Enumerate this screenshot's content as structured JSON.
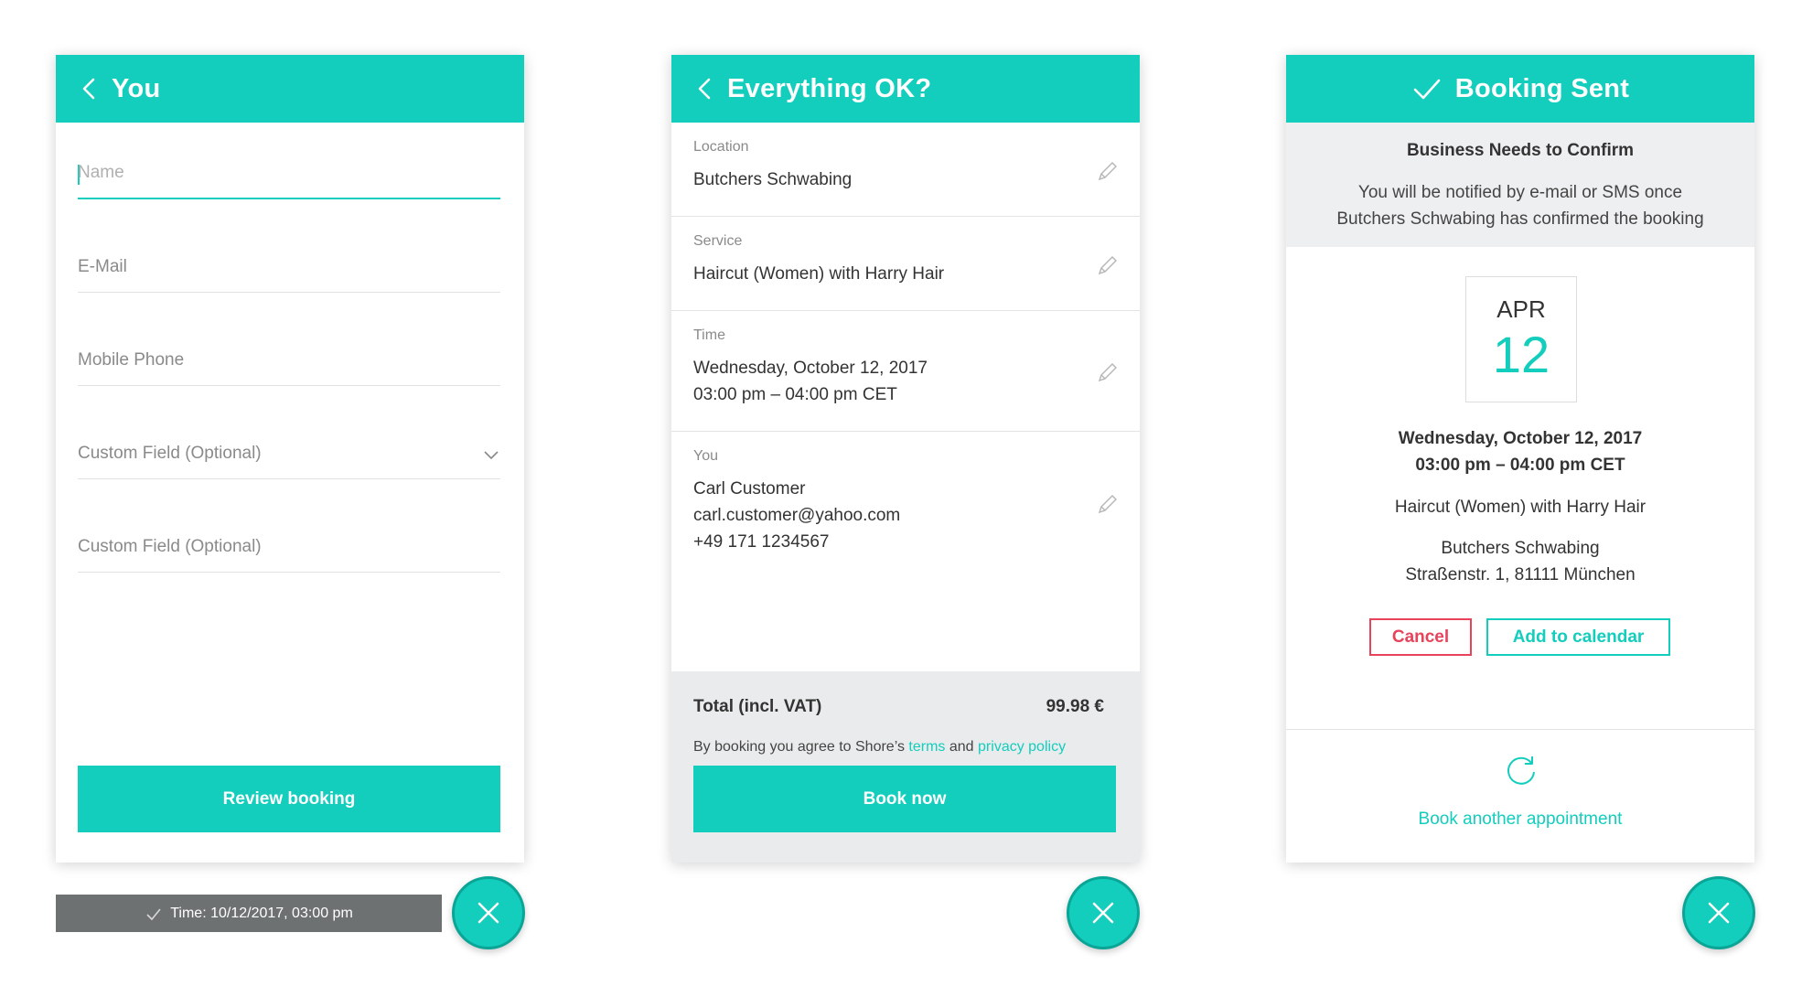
{
  "colors": {
    "accent": "#13cdbd",
    "danger": "#e8435b",
    "toast_bg": "#6e7172"
  },
  "panel_you": {
    "title": "You",
    "fields": {
      "name": "Name",
      "email": "E-Mail",
      "phone": "Mobile Phone",
      "custom1": "Custom Field (Optional)",
      "custom2": "Custom Field (Optional)"
    },
    "review_button": "Review booking"
  },
  "panel_review": {
    "title": "Everything OK?",
    "location": {
      "label": "Location",
      "value": "Butchers Schwabing"
    },
    "service": {
      "label": "Service",
      "value": "Haircut (Women) with Harry Hair"
    },
    "time": {
      "label": "Time",
      "line1": "Wednesday, October 12, 2017",
      "line2": "03:00 pm – 04:00 pm CET"
    },
    "you": {
      "label": "You",
      "name": "Carl Customer",
      "email": "carl.customer@yahoo.com",
      "phone": "+49 171 1234567"
    },
    "total_label": "Total (incl. VAT)",
    "total_value": "99.98 €",
    "agree_prefix": "By booking you agree to Shore’s",
    "terms_link": "terms",
    "agree_and": "and",
    "privacy_link": "privacy policy",
    "book_button": "Book now"
  },
  "panel_sent": {
    "title": "Booking Sent",
    "notice_title": "Business Needs to Confirm",
    "notice_line1": "You will be notified by e-mail or SMS once",
    "notice_line2": "Butchers Schwabing has confirmed the booking",
    "cal_month": "APR",
    "cal_day": "12",
    "date_line": "Wednesday, October 12, 2017",
    "time_line": "03:00 pm – 04:00 pm CET",
    "service_line": "Haircut (Women) with Harry Hair",
    "location_line1": "Butchers Schwabing",
    "location_line2": "Straßenstr. 1, 81111 München",
    "cancel_button": "Cancel",
    "calendar_button": "Add to calendar",
    "another_link": "Book another appointment"
  },
  "toast": {
    "text": "Time: 10/12/2017, 03:00 pm"
  },
  "icons": [
    "back-arrow-icon",
    "pencil-icon",
    "chevron-down-icon",
    "check-icon",
    "refresh-icon",
    "close-icon"
  ]
}
